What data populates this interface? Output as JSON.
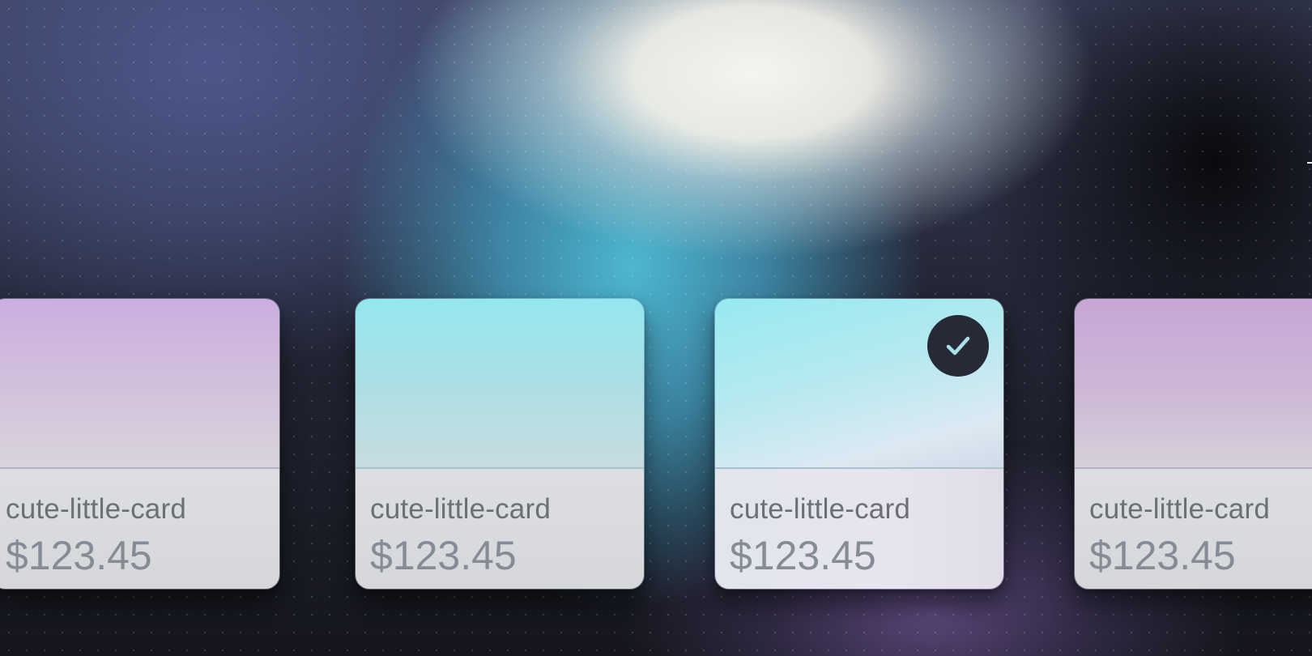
{
  "cards": [
    {
      "title": "cute-little-card",
      "price": "$123.45",
      "selected": false,
      "accent": "#caaee0"
    },
    {
      "title": "cute-little-card",
      "price": "$123.45",
      "selected": false,
      "accent": "#94e7ee"
    },
    {
      "title": "cute-little-card",
      "price": "$123.45",
      "selected": true,
      "accent": "#97e9f0",
      "badge_icon": "check-icon"
    },
    {
      "title": "cute-little-card",
      "price": "$123.45",
      "selected": false,
      "accent": "#c6a6d6"
    }
  ],
  "colors": {
    "badge_bg": "#262a36",
    "check": "#a8dfe8",
    "title_text": "#6c6f75",
    "price_text": "#868c96"
  }
}
